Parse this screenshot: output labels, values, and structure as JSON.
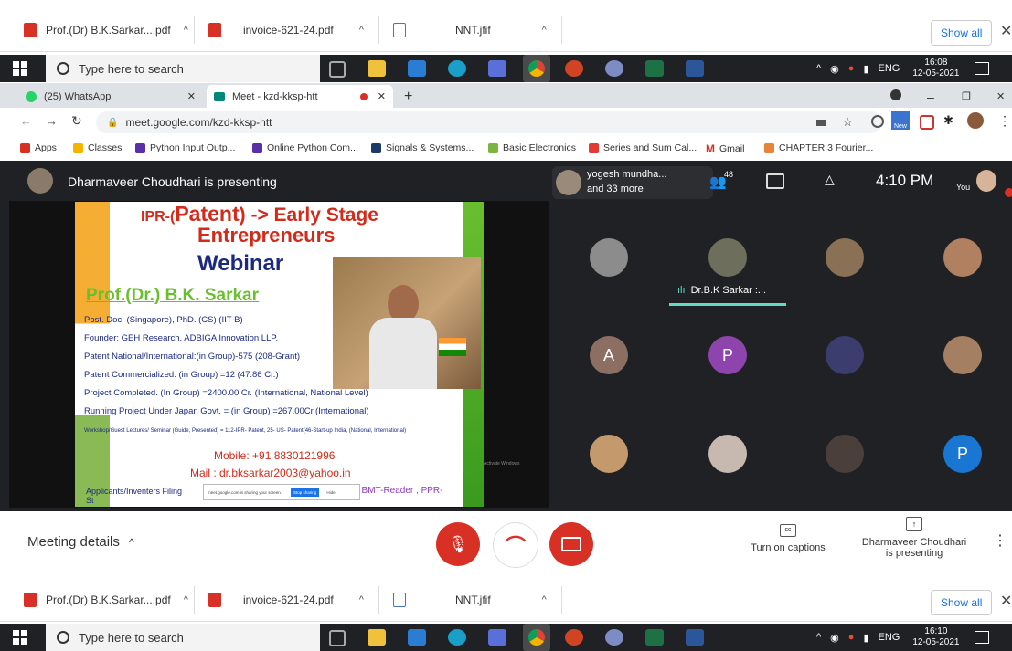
{
  "downloads": {
    "items": [
      {
        "name": "Prof.(Dr) B.K.Sarkar....pdf",
        "icon": "pdf-icon"
      },
      {
        "name": "invoice-621-24.pdf",
        "icon": "pdf-icon"
      },
      {
        "name": "NNT.jfif",
        "icon": "image-file-icon"
      }
    ],
    "show_all": "Show all",
    "close": "✕",
    "caret": "^"
  },
  "taskbar": {
    "search_placeholder": "Type here to search",
    "lang": "ENG",
    "top_time": "16:08",
    "bottom_time": "16:10",
    "date": "12-05-2021"
  },
  "browser": {
    "tabs": [
      {
        "label": "(25) WhatsApp"
      },
      {
        "label": "Meet - kzd-kksp-htt"
      }
    ],
    "new_tab": "+",
    "url": "meet.google.com/kzd-kksp-htt",
    "bookmarks": [
      "Apps",
      "Classes",
      "Python Input Outp...",
      "Online Python Com...",
      "Signals & Systems...",
      "Basic Electronics",
      "Series and Sum Cal...",
      "Gmail",
      "CHAPTER 3 Fourier..."
    ],
    "new_badge": "New"
  },
  "meet": {
    "presenting_banner": "Dharmaveer Choudhari is presenting",
    "top_participants": {
      "line1": "yogesh mundha...",
      "line2": "and 33 more"
    },
    "participant_count": "48",
    "time": "4:10 PM",
    "you_label": "You",
    "speaker_name": "Dr.B.K Sarkar :...",
    "tile_letters": [
      "A",
      "P",
      "P"
    ],
    "meeting_details": "Meeting details",
    "captions_label": "Turn on captions",
    "presenting_label_1": "Dharmaveer Choudhari",
    "presenting_label_2": "is presenting"
  },
  "slide": {
    "title_prefix": "IPR-(",
    "title_patent": "Patent",
    "title_suffix": ") -> Early Stage",
    "title_line2": "Entrepreneurs",
    "webinar": "Webinar",
    "speaker": "Prof.(Dr.) B.K. Sarkar",
    "lines": [
      "Post. Doc. (Singapore), PhD. (CS) (IIT-B)",
      "Founder: GEH Research, ADBIGA Innovation LLP.",
      "Patent National/International:(in Group)-575 (208-Grant)",
      "Patent Commercialized: (in Group) =12 (47.86 Cr.)",
      "Project Completed. (In Group) =2400.00 Cr. (International, National Level)",
      "Running Project Under Japan Govt. = (in Group) =267.00Cr.(International)"
    ],
    "small_line": "Workshop/Guest Lectures/ Seminar (Guide, Presented) = 112-IPR- Patent, 25- US- Patent(46-Start-up India, (National, International)",
    "mobile": "Mobile: +91 8830121996",
    "mail": "Mail : dr.bksarkar2003@yahoo.in",
    "bottom_left": "Applicants/Inventers Filing",
    "bottom_left2": "St",
    "bottom_right": ", BMT-Reader , PPR-",
    "share_msg": "meet.google.com is sharing your screen.",
    "stop_sharing": "Stop sharing",
    "hide": "Hide",
    "activate": "Activate Windows"
  },
  "colors": {
    "meet_bg": "#202124",
    "end_red": "#d93025",
    "slide_red": "#d42a1a",
    "slide_green": "#6abf2e",
    "slide_purple": "#8a3ab9",
    "speaker_bar": "#66d9c4"
  }
}
